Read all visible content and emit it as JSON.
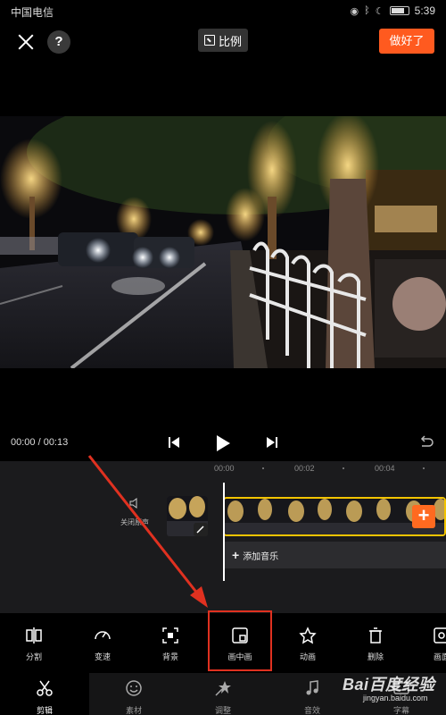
{
  "status_bar": {
    "carrier": "中国电信",
    "time": "5:39"
  },
  "top_bar": {
    "help_label": "?",
    "ratio_label": "比例",
    "done_label": "做好了"
  },
  "player": {
    "time_readout": "00:00 / 00:13"
  },
  "timeline": {
    "ruler_labels": [
      "00:00",
      "00:02",
      "00:04"
    ],
    "mute_label": "关闭原声",
    "add_music_label": "添加音乐",
    "add_clip_label": "+"
  },
  "toolbar": {
    "items": [
      {
        "label": "分割",
        "icon": "split-icon"
      },
      {
        "label": "变速",
        "icon": "speed-icon"
      },
      {
        "label": "背景",
        "icon": "background-icon"
      },
      {
        "label": "画中画",
        "icon": "picture-in-picture-icon"
      },
      {
        "label": "动画",
        "icon": "animation-icon"
      },
      {
        "label": "删除",
        "icon": "trash-icon"
      },
      {
        "label": "画面",
        "icon": "frame-icon"
      }
    ]
  },
  "bottom_nav": {
    "items": [
      {
        "label": "剪辑",
        "icon": "scissors-icon",
        "active": true
      },
      {
        "label": "素材",
        "icon": "sticker-icon",
        "active": false
      },
      {
        "label": "调整",
        "icon": "adjust-icon",
        "active": false
      },
      {
        "label": "音效",
        "icon": "music-note-icon",
        "active": false
      },
      {
        "label": "字幕",
        "icon": "subtitle-icon",
        "active": false
      }
    ]
  },
  "watermark": {
    "logo": "Bai百度经验",
    "url": "jingyan.baidu.com"
  },
  "colors": {
    "accent": "#ff5a1f",
    "clip_border": "#f3c400",
    "annotation": "#e03120"
  }
}
